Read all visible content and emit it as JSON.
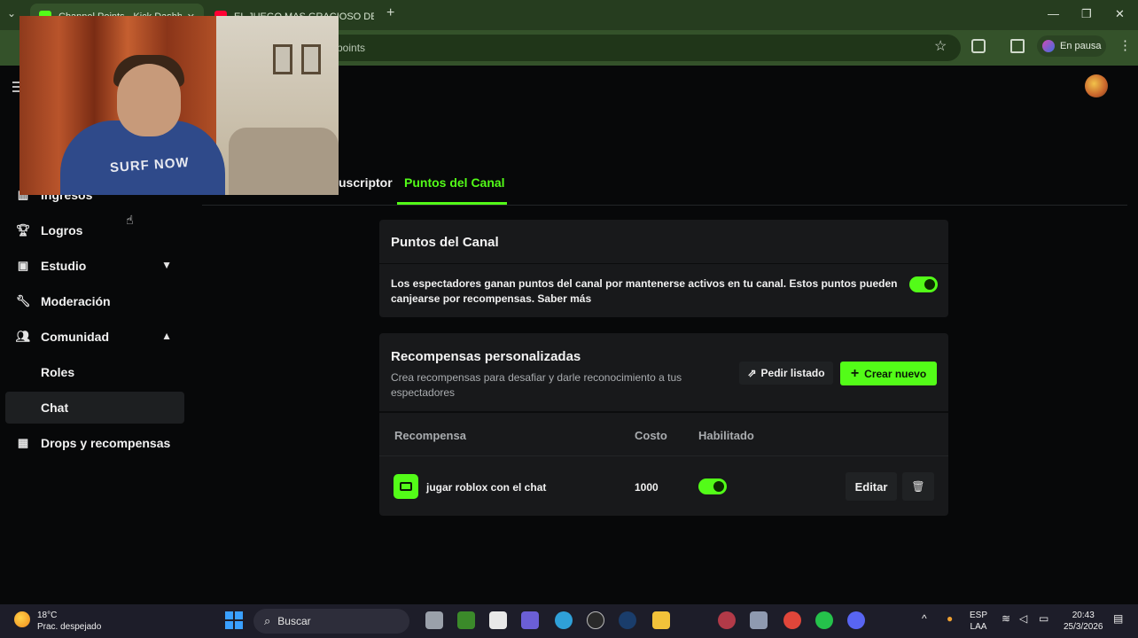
{
  "browser": {
    "tabs": [
      {
        "title": "Channel Points - Kick Dashboard",
        "active": true,
        "favicon_color": "#53fc18"
      },
      {
        "title": "EL JUEGO MAS GRACIOSO DEL",
        "active": false,
        "favicon_color": "#ff0033"
      }
    ],
    "url_fragment": "points",
    "profile_label": "En pausa"
  },
  "sidebar": {
    "items": [
      {
        "label": "Ingresos",
        "icon": "chart-icon"
      },
      {
        "label": "Logros",
        "icon": "trophy-icon"
      },
      {
        "label": "Estudio",
        "icon": "studio-icon",
        "chevron": "down"
      },
      {
        "label": "Moderación",
        "icon": "wrench-icon"
      },
      {
        "label": "Comunidad",
        "icon": "community-icon",
        "chevron": "up"
      },
      {
        "label": "Roles",
        "sub": true
      },
      {
        "label": "Chat",
        "sub": true,
        "selected": true
      },
      {
        "label": "Drops y recompensas",
        "icon": "drops-icon"
      }
    ]
  },
  "tabs": {
    "subscriber": "uscriptor",
    "active": "Puntos del Canal"
  },
  "channel_points": {
    "title": "Puntos del Canal",
    "description": "Los espectadores ganan puntos del canal por mantenerse activos en tu canal. Estos puntos pueden canjearse por recompensas. Saber más",
    "enabled": true
  },
  "rewards": {
    "title": "Recompensas personalizadas",
    "subtitle": "Crea recompensas para desafiar y darle reconocimiento a tus espectadores",
    "request_button": "Pedir listado",
    "create_button": "Crear nuevo",
    "columns": {
      "reward": "Recompensa",
      "cost": "Costo",
      "enabled": "Habilitado"
    },
    "rows": [
      {
        "name": "jugar roblox con el chat",
        "cost": "1000",
        "enabled": true,
        "edit_label": "Editar"
      }
    ]
  },
  "webcam": {
    "shirt_text": "SURF NOW"
  },
  "taskbar": {
    "weather_temp": "18°C",
    "weather_desc": "Prac. despejado",
    "search_placeholder": "Buscar",
    "lang_top": "ESP",
    "lang_bottom": "LAA",
    "time": "20:43",
    "date": "25/3/2026"
  },
  "colors": {
    "accent": "#53fc18",
    "background": "#070809",
    "card": "#18191b"
  }
}
